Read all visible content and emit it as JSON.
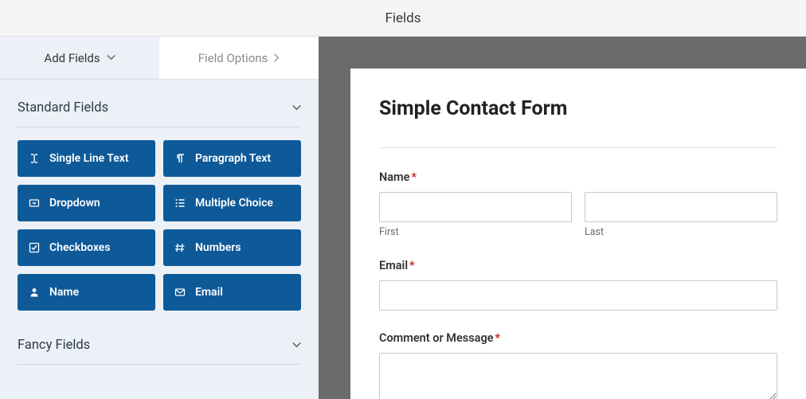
{
  "topbar": {
    "title": "Fields"
  },
  "sidebar": {
    "tabs": {
      "add": "Add Fields",
      "options": "Field Options"
    },
    "sections": {
      "standard": {
        "title": "Standard Fields",
        "items": [
          {
            "label": "Single Line Text"
          },
          {
            "label": "Paragraph Text"
          },
          {
            "label": "Dropdown"
          },
          {
            "label": "Multiple Choice"
          },
          {
            "label": "Checkboxes"
          },
          {
            "label": "Numbers"
          },
          {
            "label": "Name"
          },
          {
            "label": "Email"
          }
        ]
      },
      "fancy": {
        "title": "Fancy Fields"
      }
    }
  },
  "form": {
    "title": "Simple Contact Form",
    "name": {
      "label": "Name",
      "first": "First",
      "last": "Last"
    },
    "email": {
      "label": "Email"
    },
    "comment": {
      "label": "Comment or Message"
    },
    "required_mark": "*"
  },
  "colors": {
    "button": "#0e5a99"
  }
}
